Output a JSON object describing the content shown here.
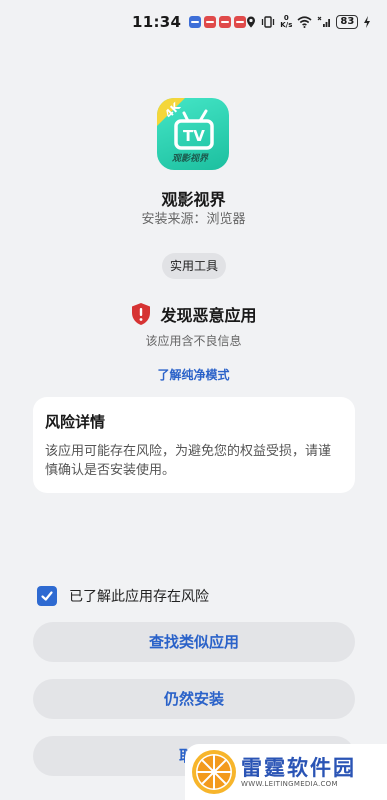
{
  "status_bar": {
    "time": "11:34",
    "notification_colors": [
      "#3e6fd8",
      "#e04a4a",
      "#e04a4a",
      "#e04a4a"
    ],
    "speed_value": "0",
    "speed_unit": "K/s",
    "battery": "83"
  },
  "app": {
    "icon_badge": "4K",
    "icon_text": "TV",
    "icon_caption": "观影视界",
    "name": "观影视界",
    "source": "安装来源：浏览器",
    "category": "实用工具"
  },
  "warning": {
    "title": "发现恶意应用",
    "subtitle": "该应用含不良信息",
    "link": "了解纯净模式"
  },
  "risk": {
    "title": "风险详情",
    "description": "该应用可能存在风险，为避免您的权益受损，请谨慎确认是否安装使用。"
  },
  "acknowledge": {
    "label": "已了解此应用存在风险",
    "checked": true
  },
  "buttons": {
    "find_similar": "查找类似应用",
    "install_anyway": "仍然安装",
    "cancel": "取消"
  },
  "watermark": {
    "title": "雷霆软件园",
    "url": "WWW.LEITINGMEDIA.COM"
  },
  "colors": {
    "accent": "#2a62c9",
    "danger": "#d63333",
    "background": "#f1f2f4",
    "app_icon": "#2cd3b2"
  }
}
